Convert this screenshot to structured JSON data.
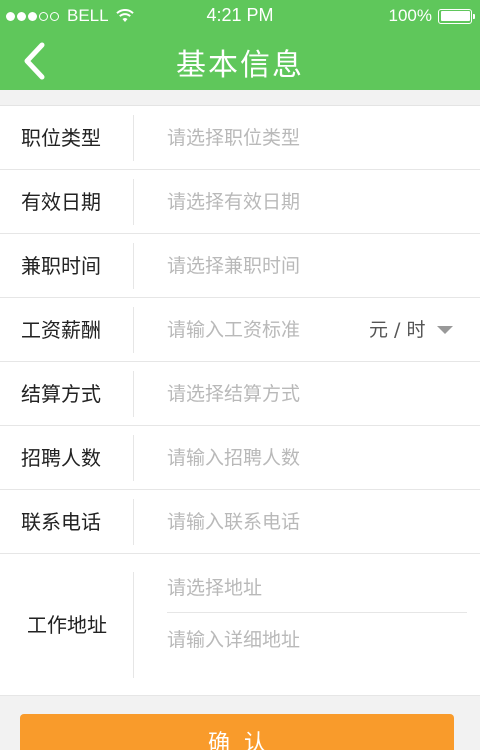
{
  "status_bar": {
    "carrier": "BELL",
    "time": "4:21 PM",
    "battery": "100%",
    "signal_bars_filled": 3,
    "signal_bars_total": 5
  },
  "nav": {
    "title": "基本信息",
    "back_icon": "chevron-left-icon"
  },
  "form": {
    "rows": [
      {
        "label": "职位类型",
        "placeholder": "请选择职位类型"
      },
      {
        "label": "有效日期",
        "placeholder": "请选择有效日期"
      },
      {
        "label": "兼职时间",
        "placeholder": "请选择兼职时间"
      },
      {
        "label": "工资薪酬",
        "placeholder": "请输入工资标准",
        "unit": "元 / 时"
      },
      {
        "label": "结算方式",
        "placeholder": "请选择结算方式"
      },
      {
        "label": "招聘人数",
        "placeholder": "请输入招聘人数"
      },
      {
        "label": "联系电话",
        "placeholder": "请输入联系电话"
      }
    ],
    "address": {
      "label": "工作地址",
      "select_placeholder": "请选择地址",
      "detail_placeholder": "请输入详细地址"
    }
  },
  "confirm_button": {
    "label": "确认"
  },
  "colors": {
    "header_green": "#5fc75b",
    "button_orange": "#f99b2b",
    "placeholder_gray": "#b9b9b9"
  }
}
